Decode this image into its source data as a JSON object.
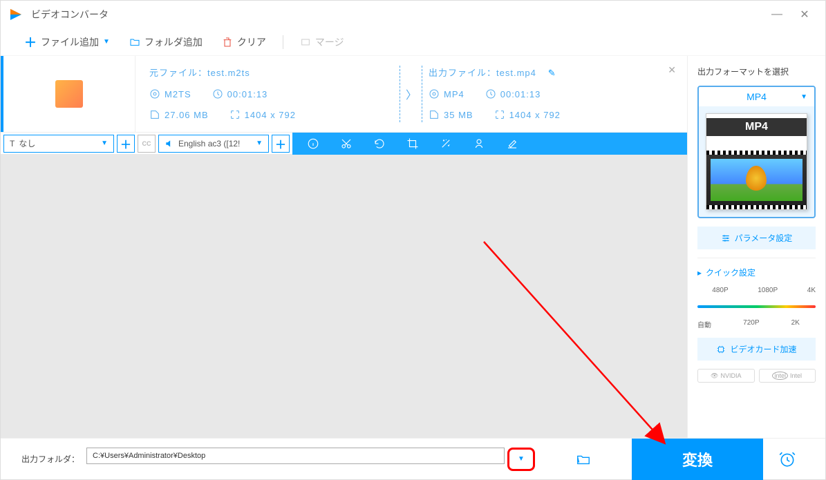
{
  "app": {
    "title": "ビデオコンバータ"
  },
  "toolbar": {
    "add_file": "ファイル追加",
    "add_folder": "フォルダ追加",
    "clear": "クリア",
    "merge": "マージ"
  },
  "file": {
    "source_label": "元ファイル：",
    "source_name": "test.m2ts",
    "source_format": "M2TS",
    "source_duration": "00:01:13",
    "source_size": "27.06 MB",
    "source_resolution": "1404 x 792",
    "output_label": "出力ファイル：",
    "output_name": "test.mp4",
    "output_format": "MP4",
    "output_duration": "00:01:13",
    "output_size": "35 MB",
    "output_resolution": "1404 x 792"
  },
  "action_bar": {
    "subtitle_label": "なし",
    "audio_label": "English ac3 ([12!"
  },
  "right_panel": {
    "title": "出力フォーマットを選択",
    "format": "MP4",
    "preview_label": "MP4",
    "param_settings": "パラメータ設定",
    "quick_settings": "クイック設定",
    "res_480": "480P",
    "res_1080": "1080P",
    "res_4k": "4K",
    "res_auto": "自動",
    "res_720": "720P",
    "res_2k": "2K",
    "gpu_accel": "ビデオカード加速",
    "nvidia": "NVIDIA",
    "intel": "Intel"
  },
  "bottom": {
    "output_folder_label": "出力フォルダ：",
    "output_path": "C:¥Users¥Administrator¥Desktop",
    "convert_button": "変換"
  }
}
